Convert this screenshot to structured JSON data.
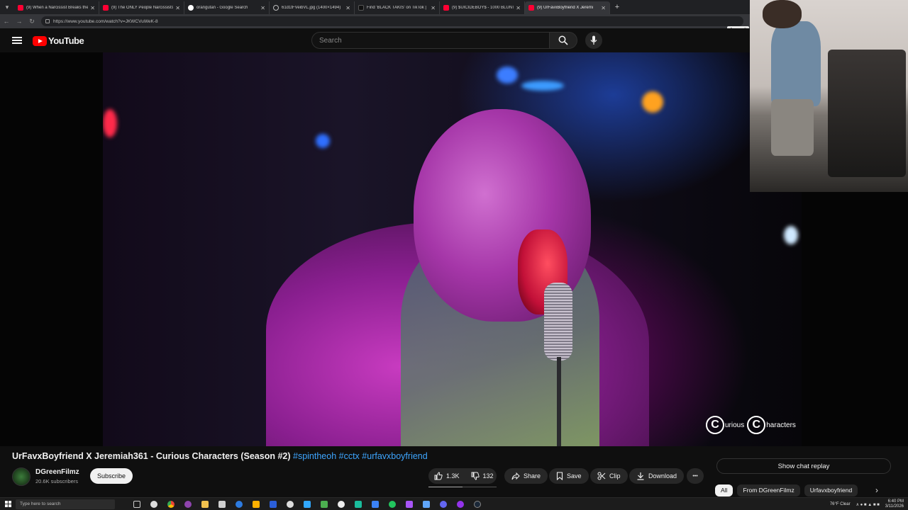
{
  "browser": {
    "tabs": [
      {
        "label": "(9) When a Narcissist Breaks the",
        "favicon": "youtube-icon"
      },
      {
        "label": "(9) The ONLY People Narcissists S",
        "favicon": "youtube-icon"
      },
      {
        "label": "orangutan - Google Search",
        "favicon": "google-icon"
      },
      {
        "label": "61d1tFVeibVL.jpg (1400×1494)",
        "favicon": "globe-icon"
      },
      {
        "label": "Find 'BLACK TAKIS' on TikTok | Tik",
        "favicon": "tiktok-icon"
      },
      {
        "label": "(9) $UICIDEBOY$ - 1000 BLUNTS (",
        "favicon": "youtube-icon"
      },
      {
        "label": "(9) UrFavxBoyfriend X Jeremi",
        "favicon": "youtube-icon",
        "active": true
      }
    ],
    "url": "https://www.youtube.com/watch?v=JKWCVuWeK-8",
    "tooltip": "App avail"
  },
  "header": {
    "logo_text": "YouTube",
    "search_placeholder": "Search"
  },
  "video": {
    "watermark_1": "urious",
    "watermark_2": "haracters",
    "watermark_letter": "C"
  },
  "details": {
    "title": "UrFavxBoyfriend X Jeremiah361 - Curious Characters (Season #2)",
    "hashtags": "#spintheoh #cctx #urfavxboyfriend",
    "channel_name": "DGreenFilmz",
    "subscribers": "20.6K subscribers",
    "subscribe_label": "Subscribe",
    "likes": "1.3K",
    "dislikes": "132",
    "share_label": "Share",
    "save_label": "Save",
    "clip_label": "Clip",
    "download_label": "Download",
    "more_label": "•••"
  },
  "sidebar": {
    "chat_replay_label": "Show chat replay",
    "chips": [
      {
        "label": "All",
        "selected": true
      },
      {
        "label": "From DGreenFilmz",
        "selected": false
      },
      {
        "label": "Urfavxboyfriend",
        "selected": false
      }
    ]
  },
  "taskbar": {
    "search_placeholder": "Type here to search",
    "weather": "76°F Clear",
    "time": "6:40 PM",
    "date": "3/11/2026"
  },
  "colors": {
    "youtube_red": "#ff0000",
    "link_blue": "#3ea6ff",
    "background": "#0f0f0f",
    "chip_bg": "#272727"
  }
}
